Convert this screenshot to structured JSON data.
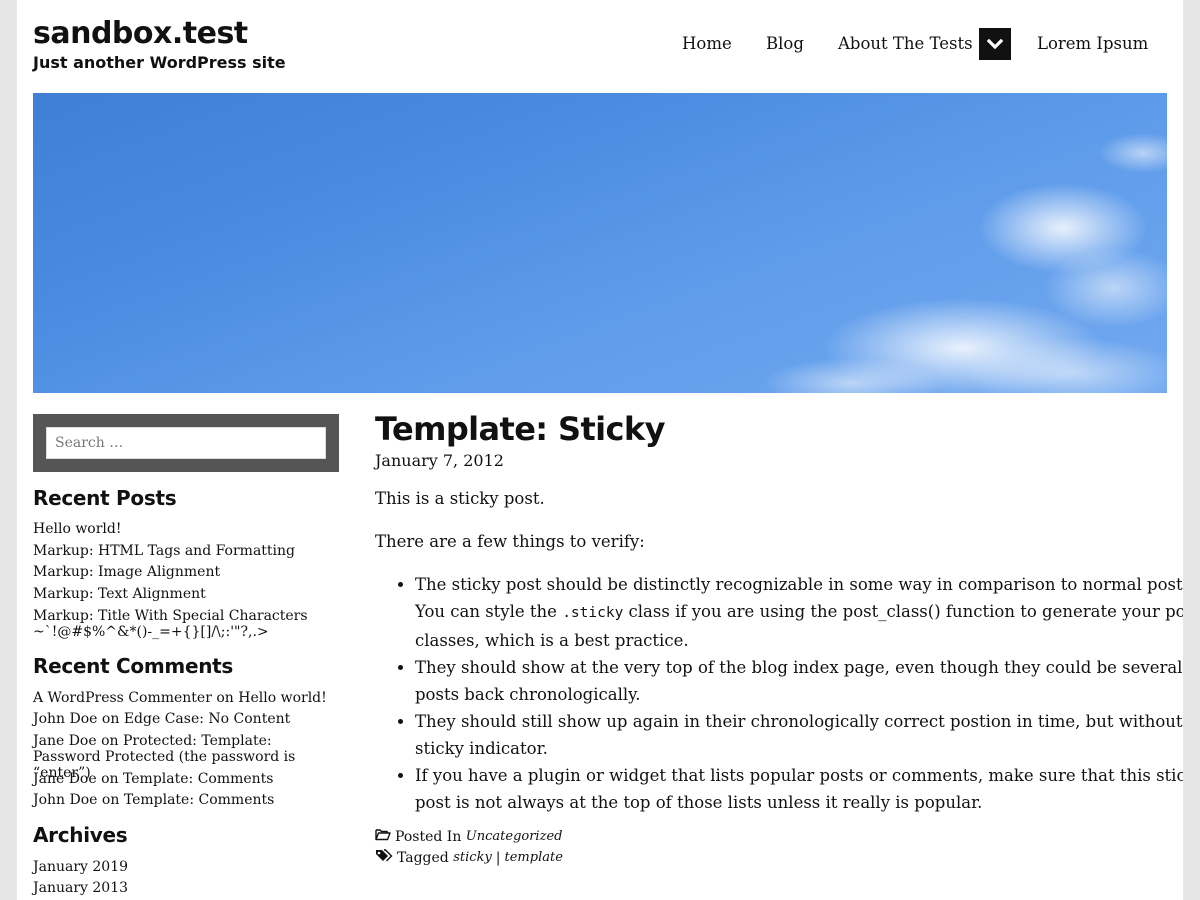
{
  "site": {
    "title": "sandbox.test",
    "description": "Just another WordPress site"
  },
  "nav": {
    "items": [
      {
        "label": "Home"
      },
      {
        "label": "Blog"
      },
      {
        "label": "About The Tests"
      },
      {
        "label": "Lorem Ipsum"
      }
    ],
    "toggle_icon": "chevron-down-icon"
  },
  "colors": {
    "page_bg": "#e6e6e6",
    "search_panel": "#555555",
    "toggle_bg": "#111111",
    "text": "#111111"
  },
  "search": {
    "placeholder": "Search …"
  },
  "sidebar": {
    "recent_posts": {
      "title": "Recent Posts",
      "items": [
        "Hello world!",
        "Markup: HTML Tags and Formatting",
        "Markup: Image Alignment",
        "Markup: Text Alignment",
        "Markup: Title With Special Characters ~`!@#$%^&*()-_=+{}[]/\\;:'\"?,.>"
      ]
    },
    "recent_comments": {
      "title": "Recent Comments",
      "items": [
        {
          "author": "A WordPress Commenter",
          "on": "on",
          "post": "Hello world!"
        },
        {
          "author": "John Doe",
          "on": "on",
          "post": "Edge Case: No Content"
        },
        {
          "author": "Jane Doe",
          "on": "on",
          "post": "Protected: Template: Password Protected (the password is “enter”)"
        },
        {
          "author": "Jane Doe",
          "on": "on",
          "post": "Template: Comments"
        },
        {
          "author": "John Doe",
          "on": "on",
          "post": "Template: Comments"
        }
      ]
    },
    "archives": {
      "title": "Archives",
      "items": [
        "January 2019",
        "January 2013"
      ]
    }
  },
  "post": {
    "title": "Template: Sticky",
    "date": "January 7, 2012",
    "intro": "This is a sticky post.",
    "lead": "There are a few things to verify:",
    "bullet1_a": "The sticky post should be distinctly recognizable in some way in comparison to normal posts. You can style the ",
    "bullet1_code": ".sticky",
    "bullet1_b": " class if you are using the post_class() function to generate your post classes, which is a best practice.",
    "bullet2": "They should show at the very top of the blog index page, even though they could be several posts back chronologically.",
    "bullet3": "They should still show up again in their chronologically correct postion in time, but without the sticky indicator.",
    "bullet4": "If you have a plugin or widget that lists popular posts or comments, make sure that this sticky post is not always at the top of those lists unless it really is popular.",
    "posted_in_label": "Posted In",
    "category": "Uncategorized",
    "tagged_label": "Tagged",
    "tags": [
      "sticky",
      "template"
    ],
    "tag_separator": "|"
  }
}
